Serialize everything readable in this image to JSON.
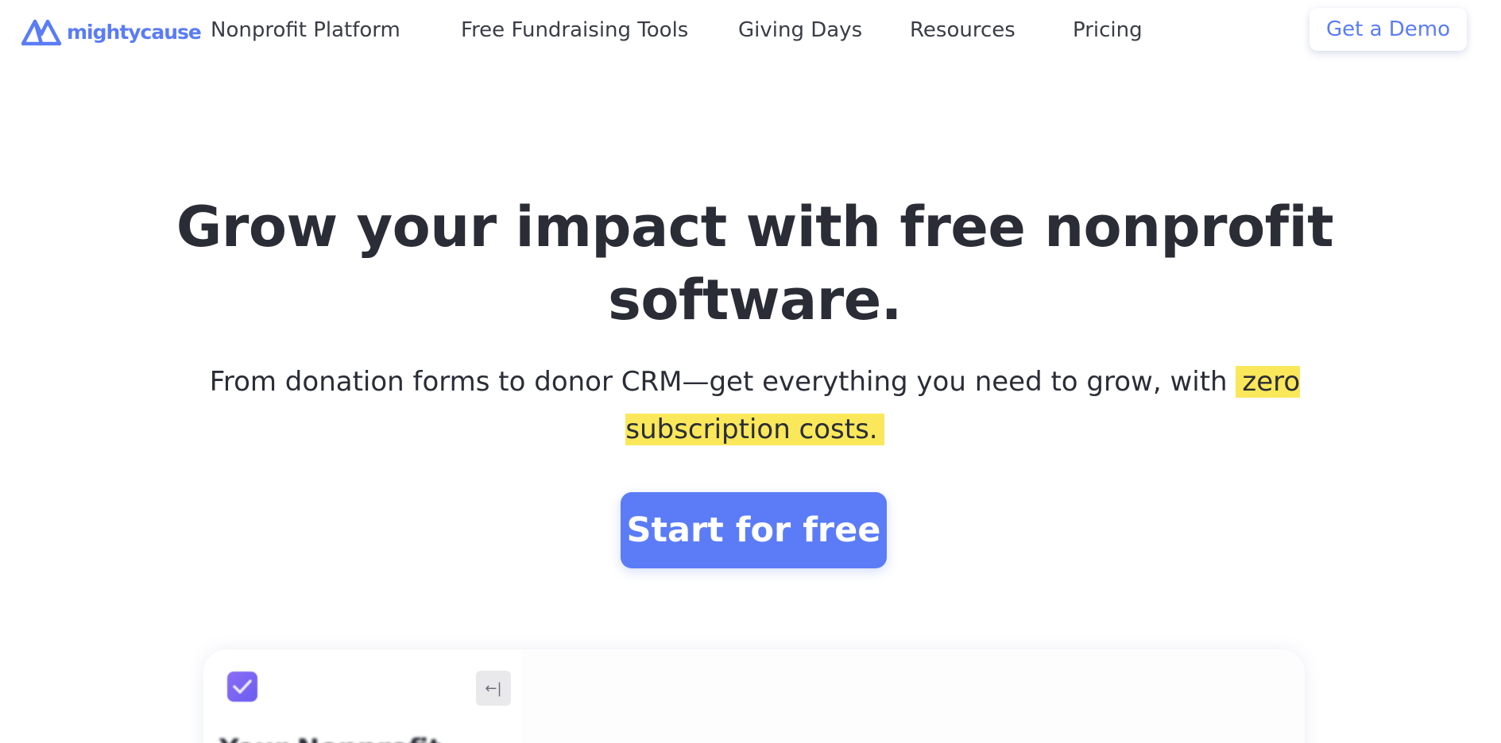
{
  "nav": {
    "logo_text": "mightycause",
    "items": [
      {
        "label": "Nonprofit Platform"
      },
      {
        "label": "Free Fundraising Tools"
      },
      {
        "label": "Giving Days"
      },
      {
        "label": "Resources"
      },
      {
        "label": "Pricing"
      }
    ],
    "demo_label": "Get a Demo"
  },
  "hero": {
    "title": "Grow your impact with free nonprofit software.",
    "subtitle_prefix": "From donation forms to donor CRM—get everything you need to grow, with ",
    "subtitle_highlight": "zero subscription costs.",
    "cta_label": "Start for free"
  },
  "preview": {
    "collapse_icon": "←|",
    "heading": "Your Nonprofit"
  },
  "colors": {
    "brand": "#5b7cf6",
    "highlight": "#fbe85a",
    "text": "#2a2d36"
  }
}
